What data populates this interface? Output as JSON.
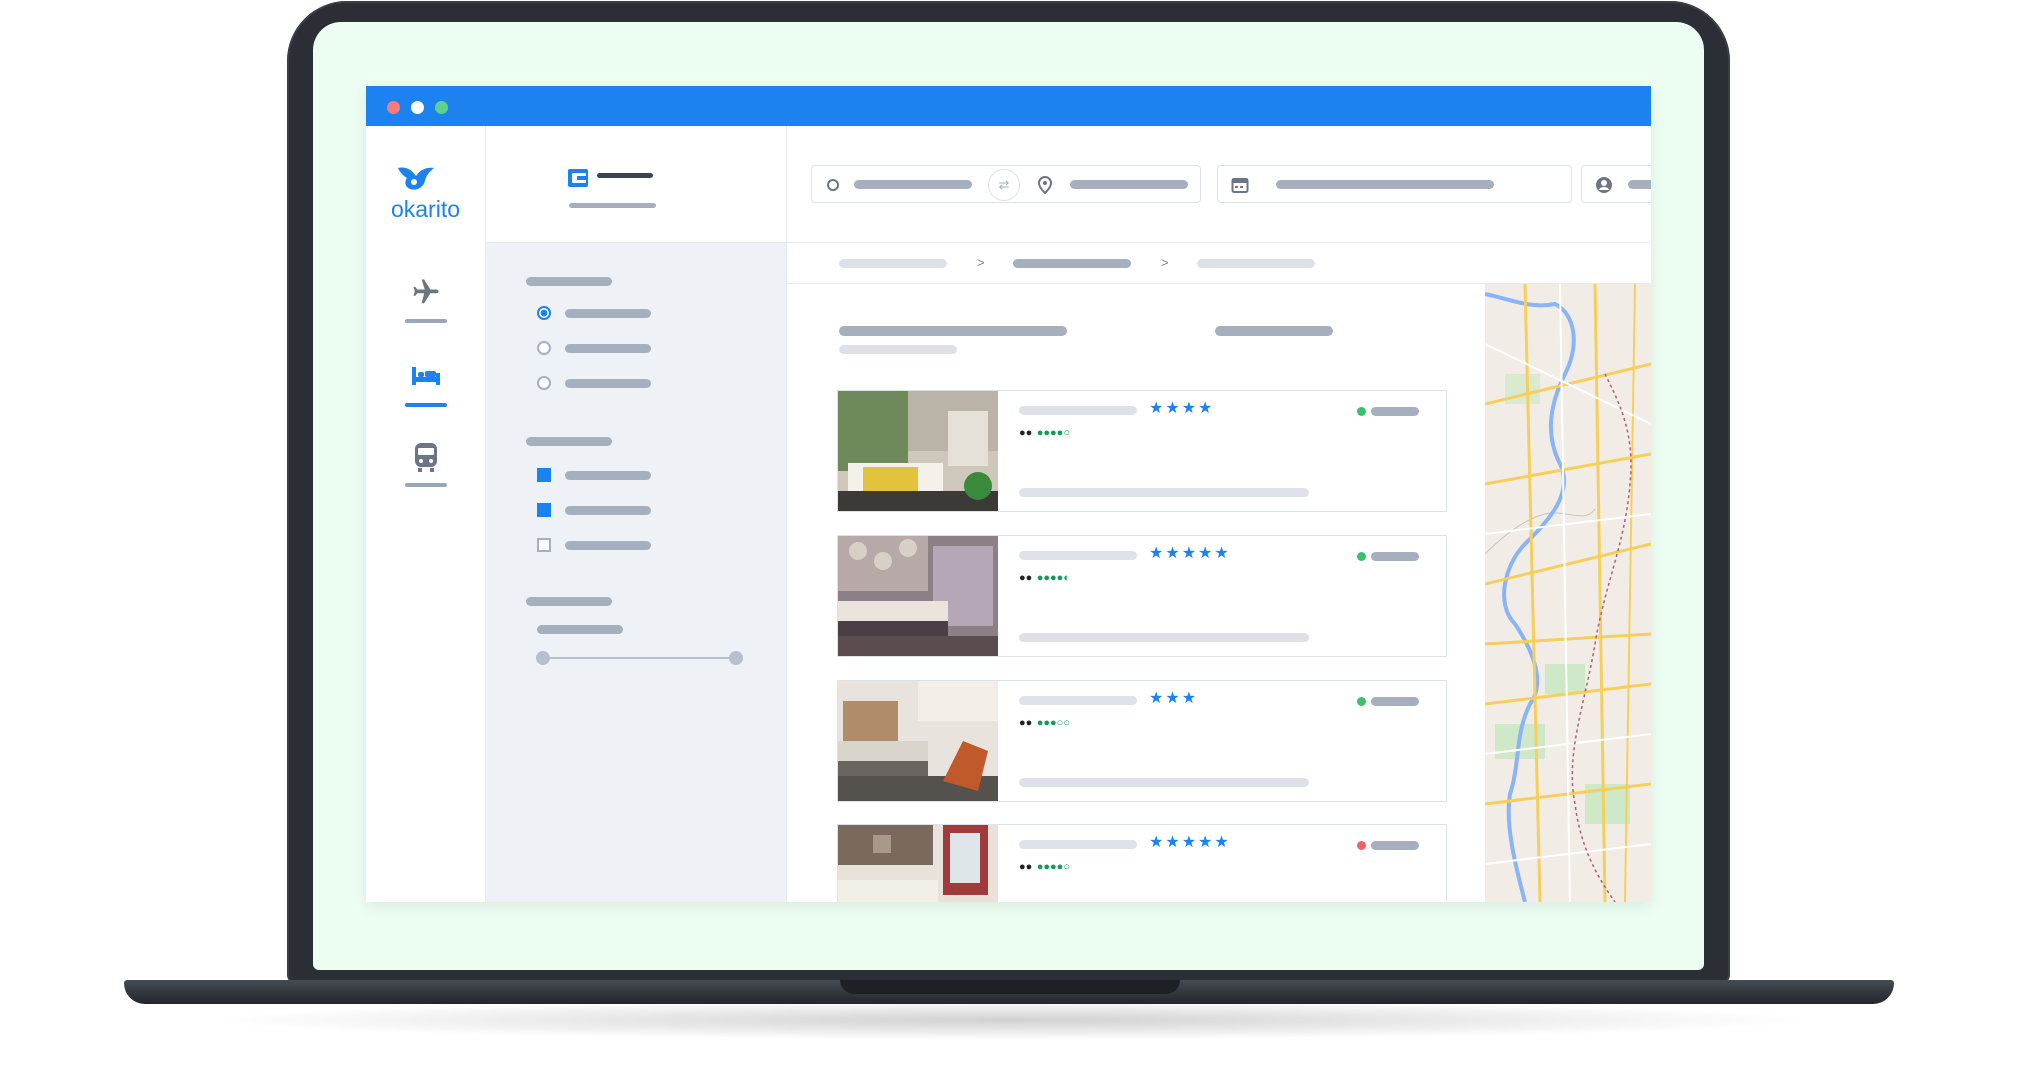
{
  "app": {
    "brand": "okarito",
    "accent_color": "#1c82f0",
    "titlebar_color": "#1c82f0",
    "window_dots": [
      "#f47c7c",
      "#ffffff",
      "#5fd38d"
    ]
  },
  "rail": {
    "items": [
      {
        "name": "flights",
        "icon": "airplane-icon",
        "active": false
      },
      {
        "name": "hotels",
        "icon": "bed-icon",
        "active": true
      },
      {
        "name": "trains",
        "icon": "train-icon",
        "active": false
      }
    ]
  },
  "search": {
    "icons": [
      "origin-circle-icon",
      "swap-icon",
      "location-pin-icon",
      "calendar-icon",
      "user-icon"
    ]
  },
  "breadcrumb": {
    "separators": [
      ">",
      ">"
    ]
  },
  "results": [
    {
      "stars": "★★★★",
      "rating_dots": "●●●●○",
      "status_color": "#37c26a",
      "thumb_colors": [
        "#6e8a5a",
        "#e3c23d",
        "#3c3a36"
      ]
    },
    {
      "stars": "★★★★★",
      "rating_dots": "●●●●◐",
      "status_color": "#37c26a",
      "thumb_colors": [
        "#8c7f86",
        "#d8d0c8",
        "#4a3f44"
      ]
    },
    {
      "stars": "★★★",
      "rating_dots": "●●●○○",
      "status_color": "#37c26a",
      "thumb_colors": [
        "#b08c6a",
        "#e8e3dc",
        "#c15a2a"
      ]
    },
    {
      "stars": "★★★★★",
      "rating_dots": "●●●●○",
      "status_color": "#f26262",
      "thumb_colors": [
        "#7a6a5e",
        "#e9e2da",
        "#a13a3a"
      ]
    }
  ]
}
